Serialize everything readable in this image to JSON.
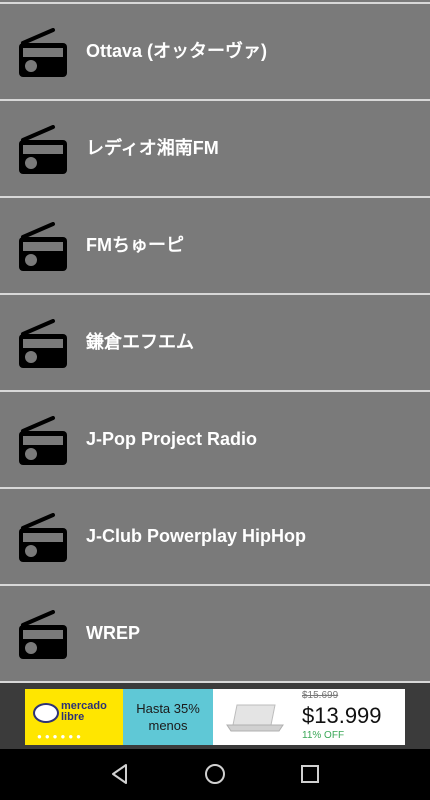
{
  "stations": [
    {
      "name": "Ottava (オッターヴァ)",
      "icon": "radio-icon"
    },
    {
      "name": "レディオ湘南FM",
      "icon": "radio-icon"
    },
    {
      "name": "FMちゅーピ",
      "icon": "radio-icon"
    },
    {
      "name": "鎌倉エフエム",
      "icon": "radio-icon"
    },
    {
      "name": "J-Pop Project Radio",
      "icon": "radio-icon"
    },
    {
      "name": "J-Club Powerplay HipHop",
      "icon": "radio-icon"
    },
    {
      "name": "WREP",
      "icon": "radio-icon"
    }
  ],
  "ad": {
    "brand": "mercado libre",
    "promo": "Hasta 35% menos",
    "old_price": "$15.699",
    "new_price": "$13.999",
    "discount": "11% OFF",
    "brand_color": "#ffe600",
    "promo_color": "#5fc8d6"
  },
  "nav": {
    "back_icon": "back-triangle-icon",
    "home_icon": "home-circle-icon",
    "recents_icon": "recents-square-icon"
  },
  "colors": {
    "list_background": "#7a7a7a",
    "divider": "#d8d8d8",
    "text": "#ffffff"
  }
}
